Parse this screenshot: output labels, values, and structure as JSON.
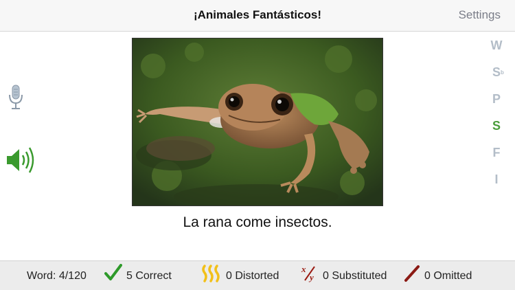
{
  "navbar": {
    "title": "¡Animales Fantásticos!",
    "settings_label": "Settings"
  },
  "controls": {
    "mic_icon": "microphone-icon",
    "speaker_icon": "speaker-icon",
    "speaker_color": "#3a9a2e",
    "mic_color": "#a9b6c4"
  },
  "photo": {
    "subject": "frog-photo"
  },
  "sentence": "La rana come insectos.",
  "letters": [
    {
      "label": "W",
      "sub": ""
    },
    {
      "label": "S",
      "sub": "b"
    },
    {
      "label": "P",
      "sub": ""
    },
    {
      "label": "S",
      "sub": ""
    },
    {
      "label": "F",
      "sub": ""
    },
    {
      "label": "I",
      "sub": ""
    }
  ],
  "active_letter_color": "#4a9d3b",
  "inactive_letter_color": "#b3bdc8",
  "status": {
    "word": "Word: 4/120",
    "correct": "5 Correct",
    "distorted": "0 Distorted",
    "substituted": "0 Substituted",
    "omitted": "0 Omitted"
  }
}
